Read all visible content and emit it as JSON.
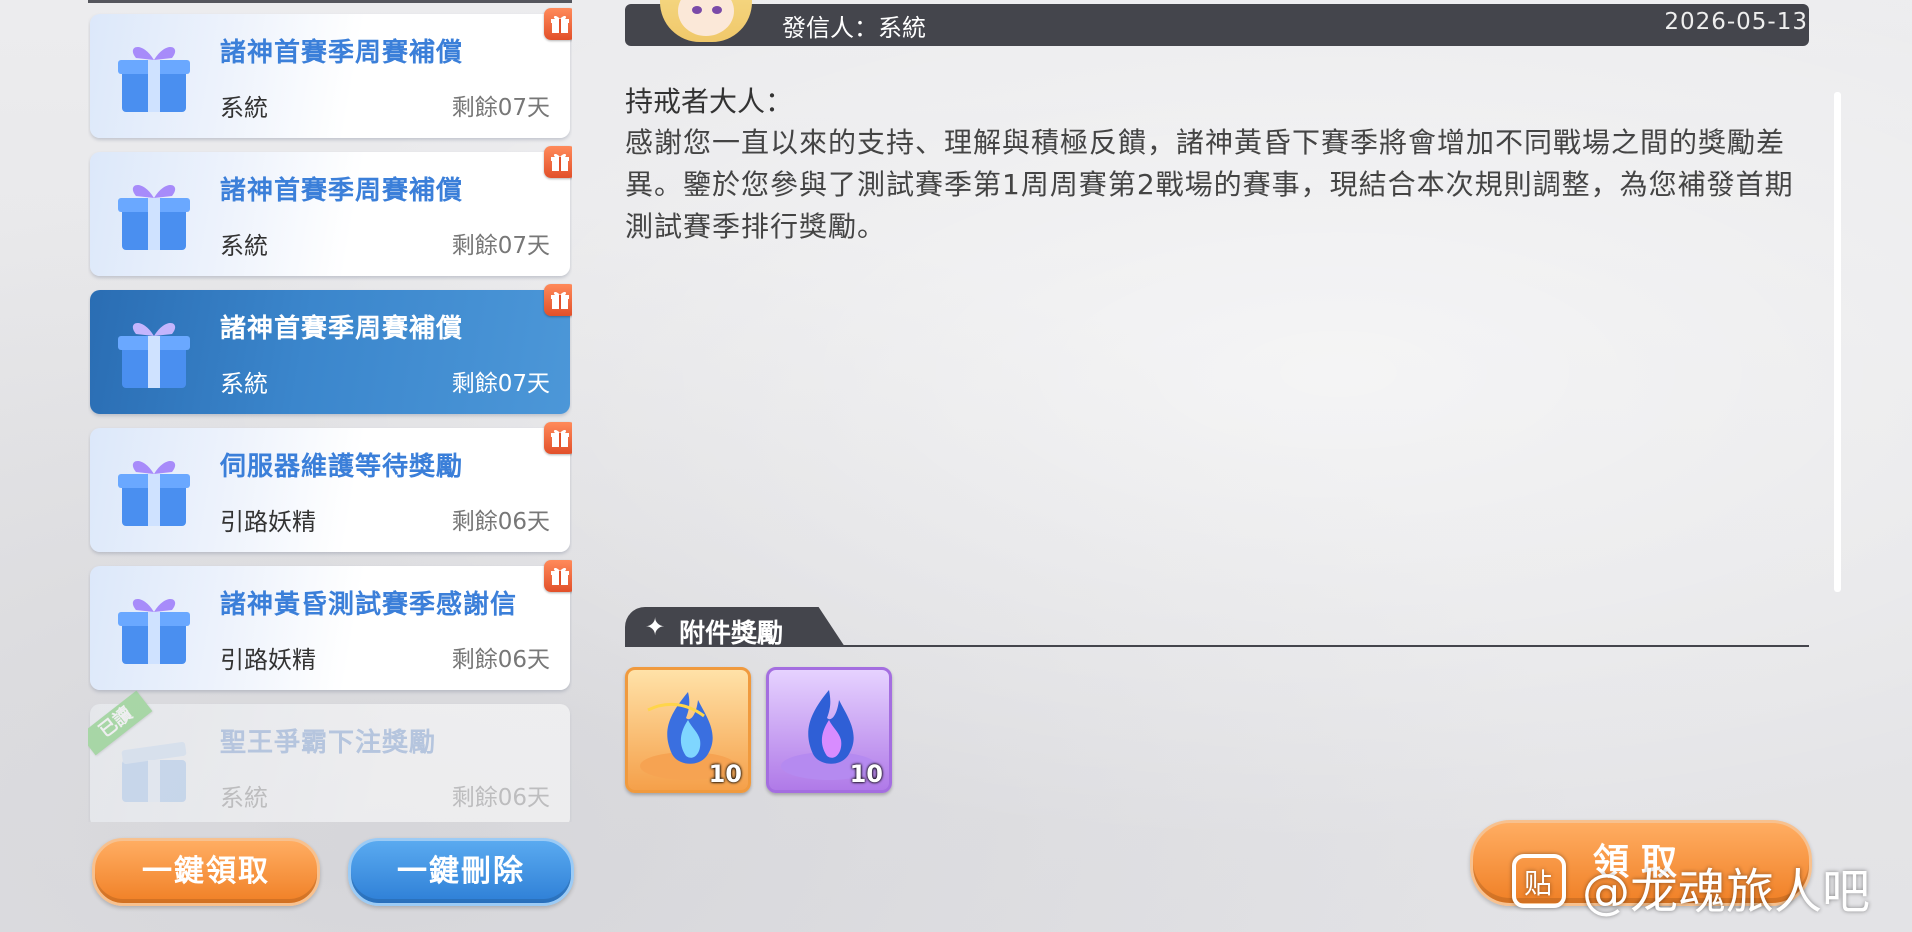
{
  "mail_list": [
    {
      "title": "諸神首賽季周賽補償",
      "sender": "系統",
      "expire": "剩餘07天",
      "state": "unread"
    },
    {
      "title": "諸神首賽季周賽補償",
      "sender": "系統",
      "expire": "剩餘07天",
      "state": "unread"
    },
    {
      "title": "諸神首賽季周賽補償",
      "sender": "系統",
      "expire": "剩餘07天",
      "state": "selected"
    },
    {
      "title": "伺服器維護等待獎勵",
      "sender": "引路妖精",
      "expire": "剩餘06天",
      "state": "unread"
    },
    {
      "title": "諸神黃昏測試賽季感謝信",
      "sender": "引路妖精",
      "expire": "剩餘06天",
      "state": "unread"
    },
    {
      "title": "聖王爭霸下注獎勵",
      "sender": "系統",
      "expire": "剩餘06天",
      "state": "read",
      "read_label": "已讀"
    }
  ],
  "buttons": {
    "claim_all": "一鍵領取",
    "delete_all": "一鍵刪除",
    "claim": "領取"
  },
  "detail": {
    "sender_label": "發信人：系統",
    "date": "2026-05-13",
    "greeting": "持戒者大人：",
    "body": "感謝您一直以來的支持、理解與積極反饋，諸神黃昏下賽季將會增加不同戰場之間的獎勵差異。鑒於您參與了測試賽季第1周周賽第2戰場的賽事，現結合本次規則調整，為您補發首期測試賽季排行獎勵。"
  },
  "attachments": {
    "label": "附件獎勵",
    "items": [
      {
        "icon": "blue-flame-orange-icon",
        "count": "10"
      },
      {
        "icon": "blue-flame-purple-icon",
        "count": "10"
      }
    ]
  },
  "watermark": {
    "logo": "贴",
    "text": "@龙魂旅人吧"
  },
  "colors": {
    "accent_blue": "#3b7fd9",
    "selected_blue": "#3b86cc",
    "orange_button": "#f08026",
    "dark_bar": "#44454c",
    "badge_red": "#e2502a"
  }
}
